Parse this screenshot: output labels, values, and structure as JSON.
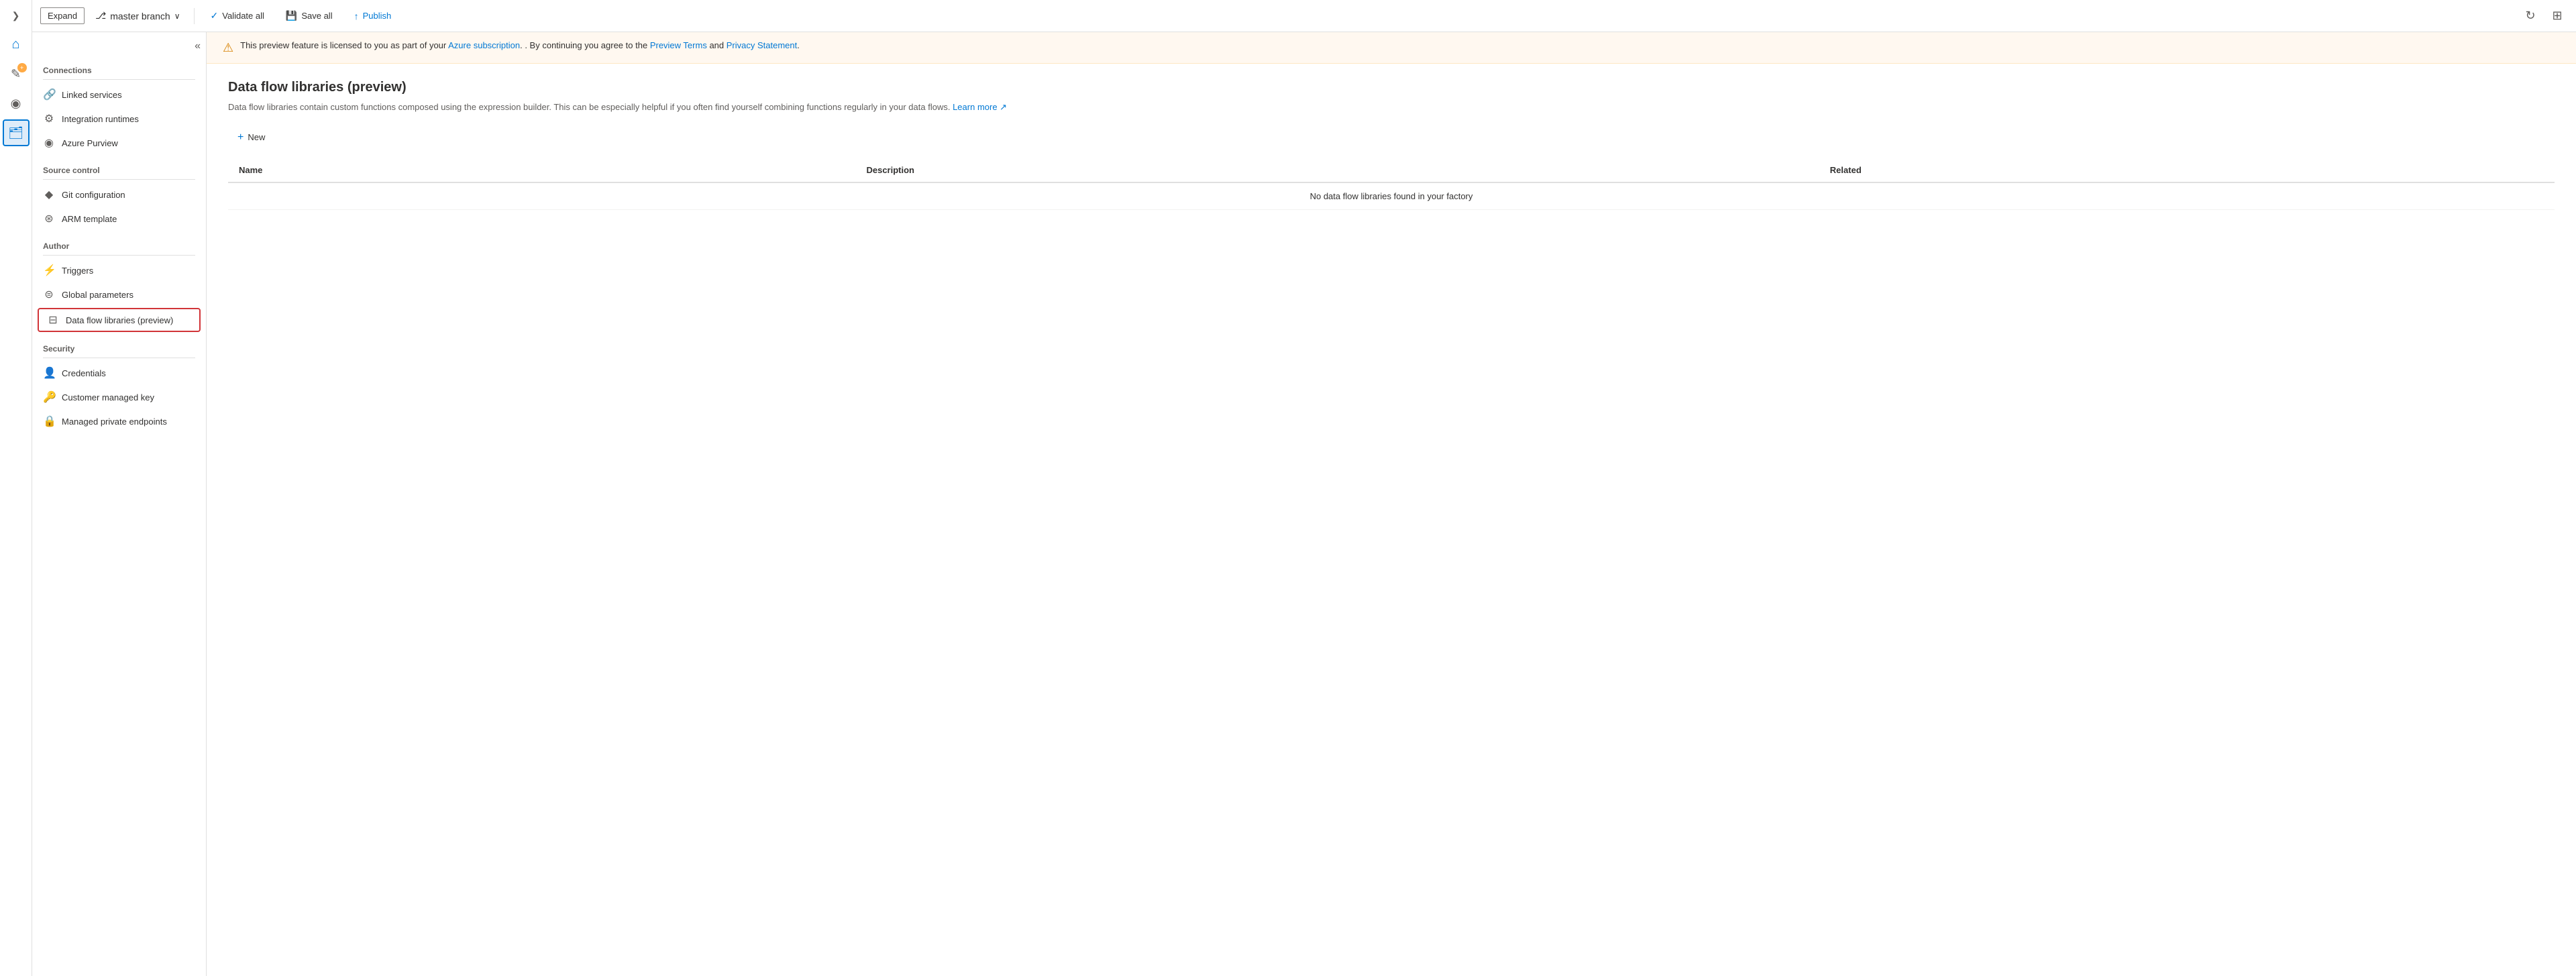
{
  "toolbar": {
    "expand_label": "Expand",
    "branch_label": "master branch",
    "validate_all_label": "Validate all",
    "save_all_label": "Save all",
    "publish_label": "Publish"
  },
  "banner": {
    "warning_text": "This preview feature is licensed to you as part of your",
    "azure_subscription_link": "Azure subscription",
    "middle_text": ". By continuing you agree to the",
    "preview_terms_link": "Preview Terms",
    "and_text": "and",
    "privacy_statement_link": "Privacy Statement",
    "end_text": "."
  },
  "page": {
    "title": "Data flow libraries (preview)",
    "description": "Data flow libraries contain custom functions composed using the expression builder. This can be especially helpful if you often find yourself combining functions regularly in your data flows.",
    "learn_more_label": "Learn more",
    "new_button_label": "New",
    "table": {
      "columns": [
        "Name",
        "Description",
        "Related"
      ],
      "empty_message": "No data flow libraries found in your factory"
    }
  },
  "sidebar": {
    "connections_label": "Connections",
    "linked_services_label": "Linked services",
    "integration_runtimes_label": "Integration runtimes",
    "azure_purview_label": "Azure Purview",
    "source_control_label": "Source control",
    "git_configuration_label": "Git configuration",
    "arm_template_label": "ARM template",
    "author_label": "Author",
    "triggers_label": "Triggers",
    "global_parameters_label": "Global parameters",
    "data_flow_libraries_label": "Data flow libraries (preview)",
    "security_label": "Security",
    "credentials_label": "Credentials",
    "customer_managed_key_label": "Customer managed key",
    "managed_private_endpoints_label": "Managed private endpoints"
  },
  "icons": {
    "home": "⌂",
    "pencil": "✎",
    "monitor": "◈",
    "briefcase": "⊞",
    "chevron_down": "∨",
    "chevron_left": "❮",
    "double_chevron_left": "«",
    "double_arrow": "⟩",
    "checkmark": "✓",
    "save": "💾",
    "upload": "↑",
    "refresh": "↻",
    "grid": "⊞",
    "link": "🔗",
    "runtime": "⚙",
    "eye": "◉",
    "diamond": "◆",
    "gear_circle": "⊛",
    "lightning": "⚡",
    "sliders": "⊜",
    "dataflow": "⊟",
    "person_key": "👤",
    "key_circle": "🔑",
    "lock_cloud": "🔒",
    "plus": "+"
  }
}
